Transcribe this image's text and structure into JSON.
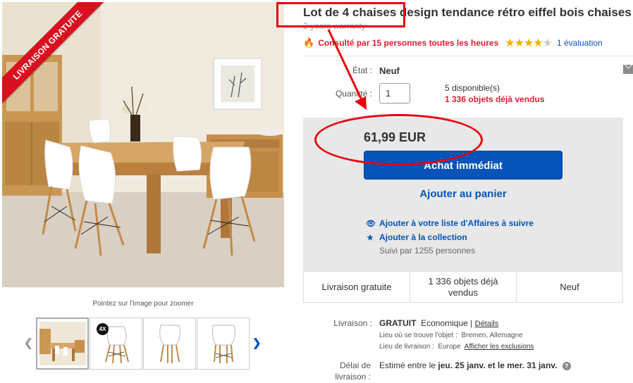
{
  "listing": {
    "ribbon": "LIVRAISON GRATUITE",
    "zoom_hint": "Pointez sur l'image pour zoomer",
    "thumb_badge": "4X",
    "title": "Lot de 4 chaises design tendance rétro eiffel bois chaises",
    "warranty": "2 years warranty",
    "views": "Consulté par 15 personnes toutes les heures",
    "rating": {
      "stars_filled": 4,
      "stars_total": 5,
      "link": "1 évaluation"
    }
  },
  "details": {
    "condition_label": "État :",
    "condition_value": "Neuf",
    "quantity_label": "Quantité :",
    "quantity_value": "1",
    "available": "5 disponible(s)",
    "sold": "1 336 objets déjà vendus"
  },
  "buy_box": {
    "price": "61,99 EUR",
    "buy_now": "Achat immédiat",
    "add_to_cart": "Ajouter au panier",
    "watch": "Ajouter à votre liste d'Affaires à suivre",
    "collection": "Ajouter à la collection",
    "followers": "Suivi par 1255 personnes"
  },
  "features": [
    "Livraison gratuite",
    "1 336 objets déjà vendus",
    "Neuf"
  ],
  "shipping": {
    "label": "Livraison :",
    "free": "GRATUIT",
    "method": "Economique |",
    "details_link": "Détails",
    "location_label": "Lieu où se trouve l'objet :",
    "location": "Bremen, Allemagne",
    "ship_to_label": "Lieu de livraison :",
    "ship_to": "Europe",
    "exclusions_link": "Afficher les exclusions",
    "delay_label_1": "Délai de",
    "delay_label_2": "livraison :",
    "estimate_prefix": "Estimé entre le",
    "date_from": "jeu. 25 janv.",
    "estimate_mid": "et le",
    "date_to": "mer. 31 janv."
  },
  "colors": {
    "link": "#0654ba",
    "alert": "#dd1e31",
    "star": "#f5af02",
    "annotation": "#e8000f"
  },
  "icons": [
    "fire-icon",
    "star-icon",
    "mail-icon",
    "eye-icon",
    "star-icon",
    "help-icon",
    "chevron-left-icon",
    "chevron-right-icon"
  ]
}
